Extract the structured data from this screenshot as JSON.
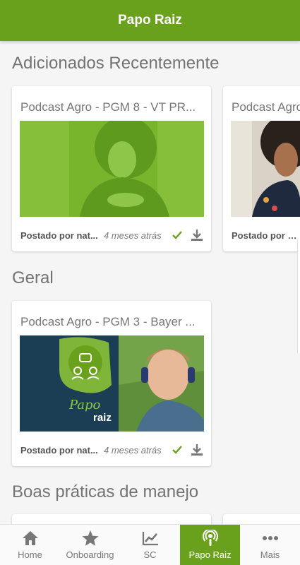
{
  "app": {
    "title": "Papo Raiz",
    "accent": "#6aa11c"
  },
  "sections": [
    {
      "title": "Adicionados Recentemente",
      "cards": [
        {
          "title": "Podcast Agro - PGM 8 - VT PR...",
          "posted": "Postado por nat...",
          "ago": "4 meses atrás"
        },
        {
          "title": "Podcast Agro",
          "posted": "Postado por nat",
          "ago": ""
        }
      ]
    },
    {
      "title": "Geral",
      "cards": [
        {
          "title": "Podcast Agro - PGM 3 - Bayer ...",
          "posted": "Postado por nat...",
          "ago": "4 meses atrás",
          "image_brand_line1": "Papo",
          "image_brand_line2": "raiz"
        }
      ]
    },
    {
      "title": "Boas práticas de manejo",
      "cards": []
    }
  ],
  "bottom_nav": [
    {
      "label": "Home",
      "icon": "home-icon"
    },
    {
      "label": "Onboarding",
      "icon": "star-icon"
    },
    {
      "label": "SC",
      "icon": "chart-icon"
    },
    {
      "label": "Papo Raiz",
      "icon": "podcast-icon",
      "active": true
    },
    {
      "label": "Mais",
      "icon": "more-icon"
    }
  ]
}
